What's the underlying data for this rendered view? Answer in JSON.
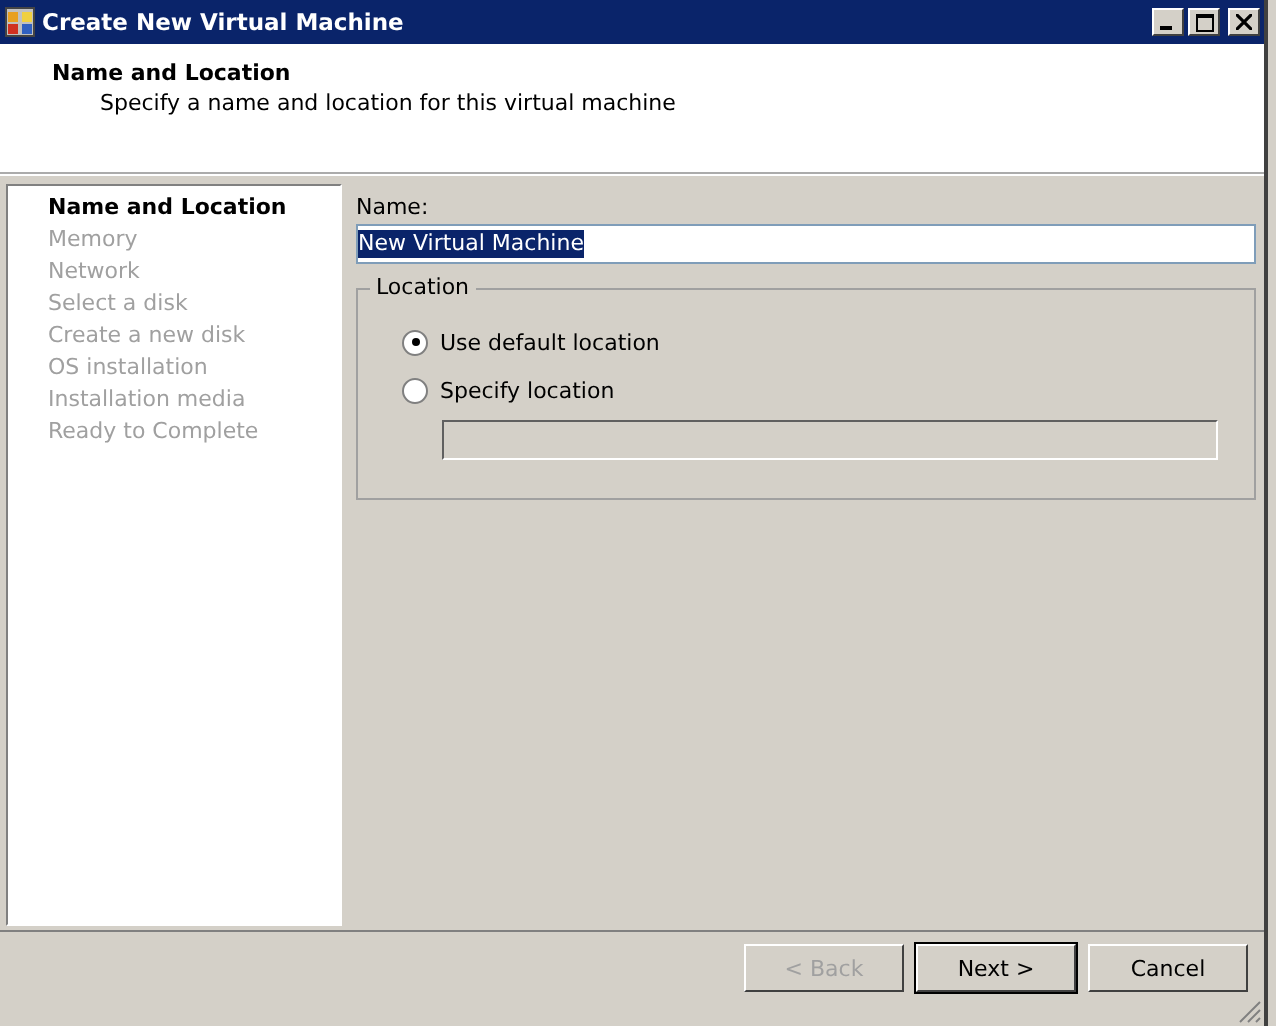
{
  "window": {
    "title": "Create New Virtual Machine"
  },
  "header": {
    "title": "Name and Location",
    "subtitle": "Specify a name and location for this virtual machine"
  },
  "steps": [
    {
      "label": "Name and Location",
      "selected": true
    },
    {
      "label": "Memory",
      "selected": false
    },
    {
      "label": "Network",
      "selected": false
    },
    {
      "label": "Select a disk",
      "selected": false
    },
    {
      "label": "Create a new disk",
      "selected": false
    },
    {
      "label": "OS installation",
      "selected": false
    },
    {
      "label": "Installation media",
      "selected": false
    },
    {
      "label": "Ready to Complete",
      "selected": false
    }
  ],
  "name_field": {
    "label": "Name:",
    "value": "New Virtual Machine"
  },
  "location": {
    "title": "Location",
    "options": [
      {
        "label": "Use default location",
        "selected": true
      },
      {
        "label": "Specify location",
        "selected": false
      }
    ],
    "path_field": {
      "disabled": true
    }
  },
  "buttons": [
    {
      "label": "< Back",
      "disabled": true,
      "default": false
    },
    {
      "label": "Next >",
      "disabled": false,
      "default": true
    },
    {
      "label": "Cancel",
      "disabled": false,
      "default": false
    }
  ]
}
